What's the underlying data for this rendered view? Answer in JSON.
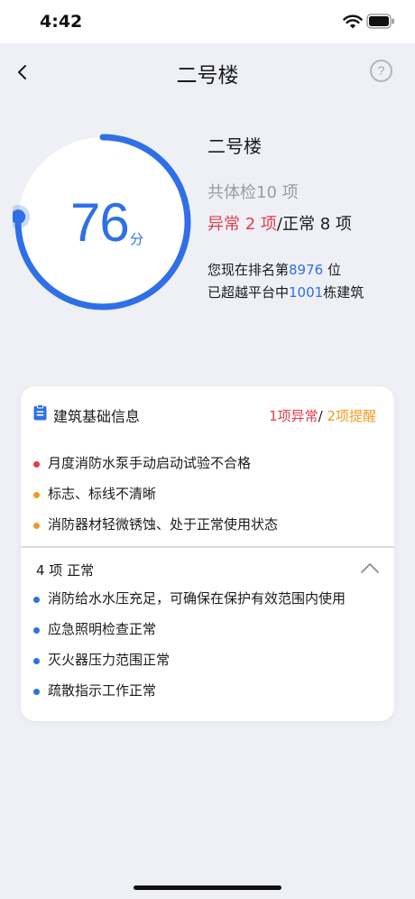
{
  "status_bar": {
    "time": "4:42"
  },
  "nav": {
    "title": "二号楼",
    "help_symbol": "?"
  },
  "score": {
    "value": "76",
    "unit": "分",
    "progress_fraction": 0.76
  },
  "building": {
    "name": "二号楼",
    "total_checks": "共体检10 项",
    "abnormal_text": "异常 2 项",
    "normal_text": "/正常 8 项",
    "rank_prefix": "您现在排名第",
    "rank_value": "8976",
    "rank_suffix": " 位",
    "exceed_prefix": "已超越平台中",
    "exceed_value": "1001",
    "exceed_suffix": "栋建筑"
  },
  "card": {
    "title": "建筑基础信息",
    "abnormal_summary": "1项异常",
    "separator": "/ ",
    "warning_summary": "2项提醒",
    "issues": [
      {
        "text": "月度消防水泵手动启动试验不合格",
        "level": "abnormal"
      },
      {
        "text": "标志、标线不清晰",
        "level": "warning"
      },
      {
        "text": "消防器材轻微锈蚀、处于正常使用状态",
        "level": "warning"
      }
    ],
    "normal_header": "4 项 正常",
    "normal_items": [
      {
        "text": "消防给水水压充足，可确保在保护有效范围内使用"
      },
      {
        "text": "应急照明检查正常"
      },
      {
        "text": "灭火器压力范围正常"
      },
      {
        "text": "疏散指示工作正常"
      }
    ]
  },
  "colors": {
    "accent": "#2f6fe8",
    "abnormal": "#e23d4f",
    "warning": "#f39a21",
    "background": "#eef0f5"
  },
  "icons": [
    "wifi-icon",
    "battery-icon",
    "back-icon",
    "help-icon",
    "clipboard-icon",
    "chevron-up-icon"
  ]
}
